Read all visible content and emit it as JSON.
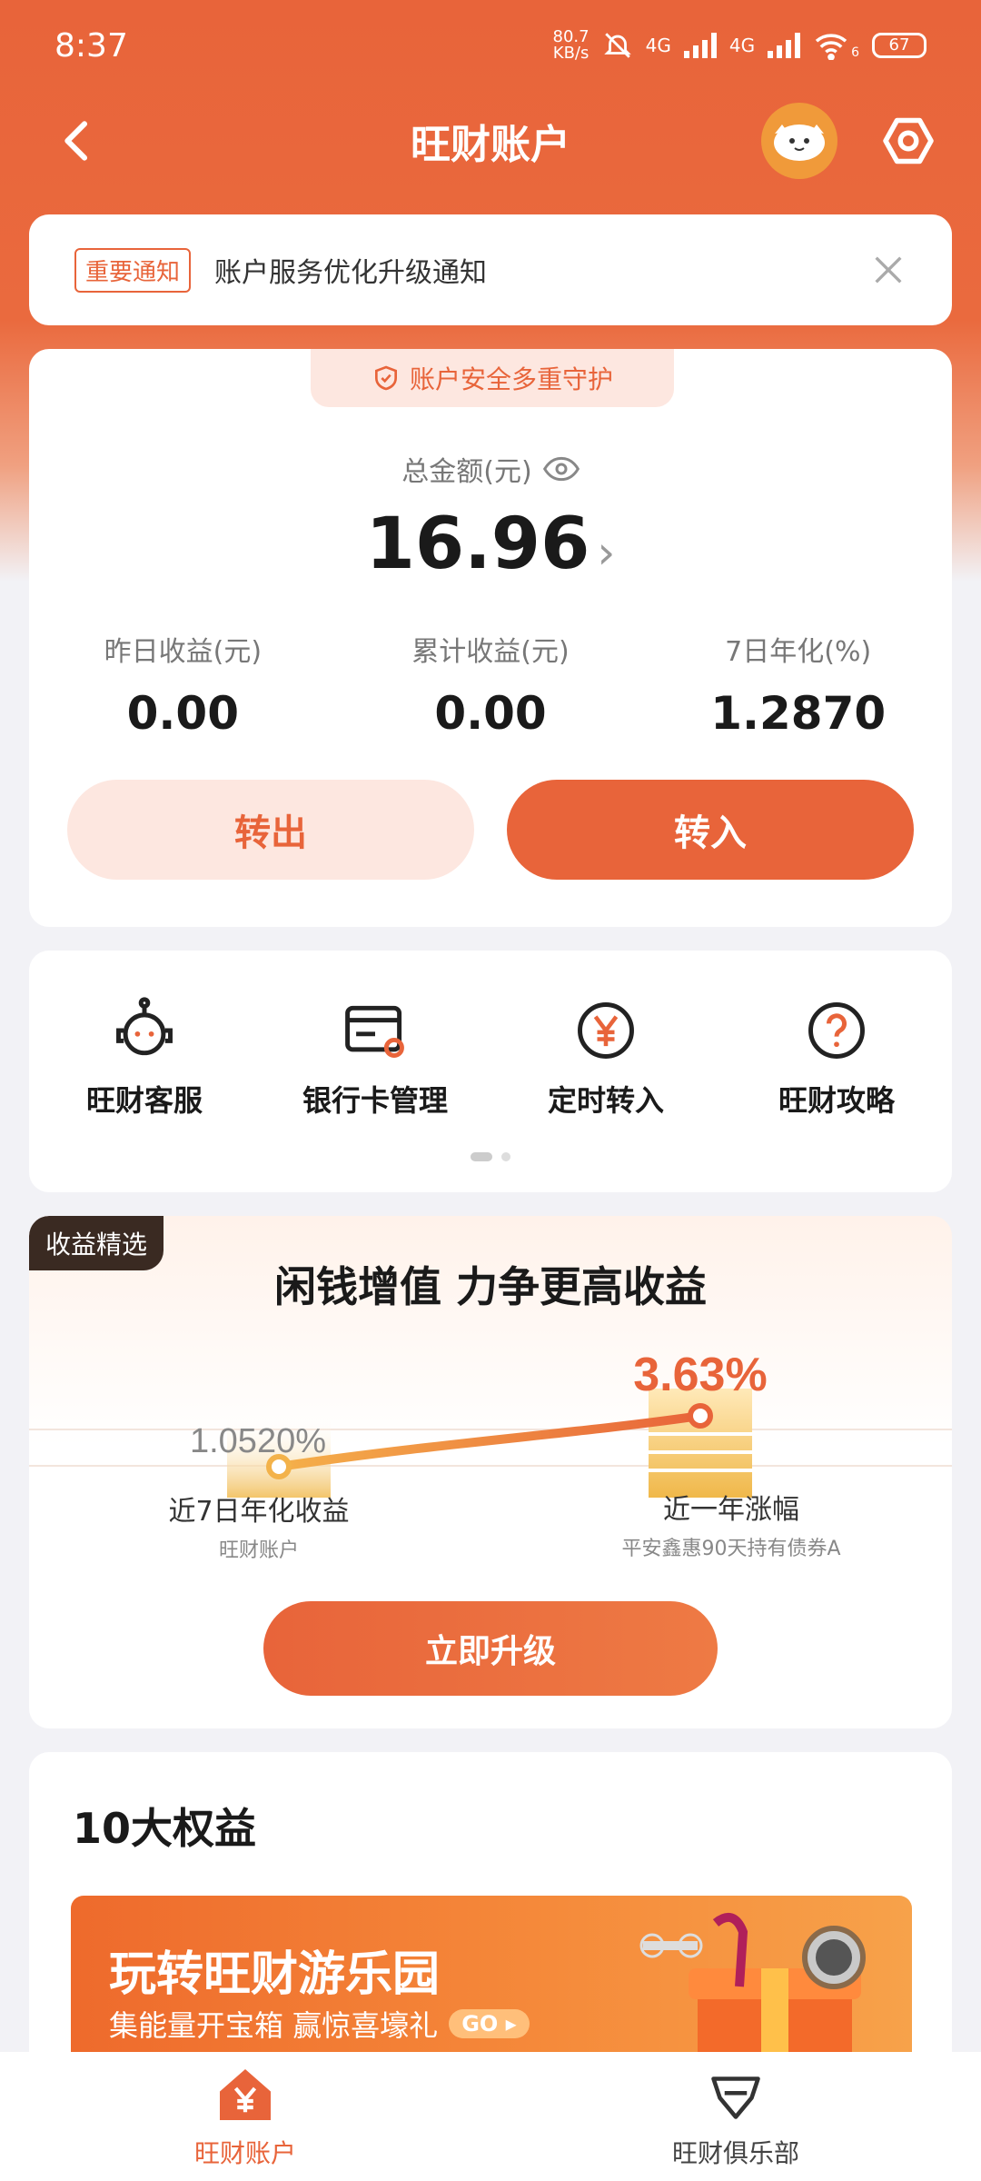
{
  "status_bar": {
    "time": "8:37",
    "net_speed_value": "80.7",
    "net_speed_unit": "KB/s",
    "signal1": "4G",
    "signal2": "4G",
    "wifi_badge": "6",
    "battery": "67"
  },
  "nav": {
    "title": "旺财账户"
  },
  "notice": {
    "badge": "重要通知",
    "text": "账户服务优化升级通知"
  },
  "account": {
    "security_tag": "账户安全多重守护",
    "total_label": "总金额(元)",
    "total_value": "16.96",
    "stats": [
      {
        "label": "昨日收益(元)",
        "value": "0.00"
      },
      {
        "label": "累计收益(元)",
        "value": "0.00"
      },
      {
        "label": "7日年化(%)",
        "value": "1.2870"
      }
    ],
    "transfer_out": "转出",
    "transfer_in": "转入"
  },
  "services": {
    "items": [
      {
        "label": "旺财客服",
        "icon": "customer-service-icon"
      },
      {
        "label": "银行卡管理",
        "icon": "bank-card-icon"
      },
      {
        "label": "定时转入",
        "icon": "yen-circle-icon"
      },
      {
        "label": "旺财攻略",
        "icon": "question-icon"
      }
    ]
  },
  "promo": {
    "tag": "收益精选",
    "title": "闲钱增值 力争更高收益",
    "left_value": "1.0520%",
    "left_label": "近7日年化收益",
    "left_sub": "旺财账户",
    "right_value": "3.63%",
    "right_label": "近一年涨幅",
    "right_sub": "平安鑫惠90天持有债券A",
    "button": "立即升级"
  },
  "benefits": {
    "title": "10大权益",
    "banner_title": "玩转旺财游乐园",
    "banner_sub": "集能量开宝箱 赢惊喜壕礼",
    "banner_go": "GO"
  },
  "tabbar": {
    "items": [
      {
        "label": "旺财账户",
        "active": true
      },
      {
        "label": "旺财俱乐部",
        "active": false
      }
    ]
  },
  "colors": {
    "accent": "#e8643a",
    "light_accent": "#fde7e0",
    "bg": "#f2f2f6"
  }
}
